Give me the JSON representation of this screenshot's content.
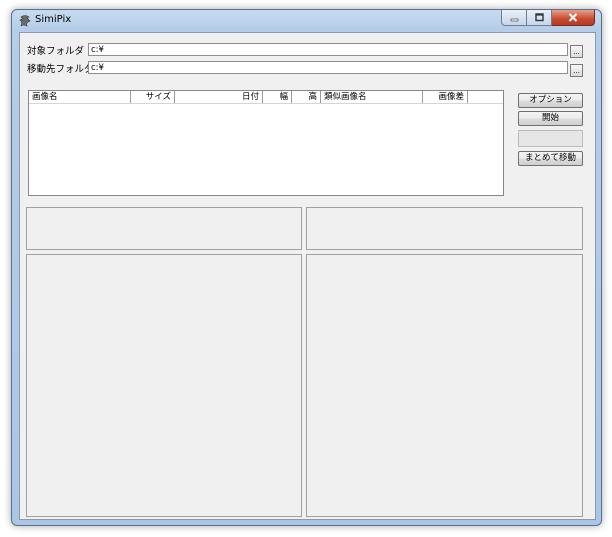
{
  "window": {
    "title": "SimiPix"
  },
  "folders": {
    "target_label": "対象フォルダ",
    "target_value": "c:¥",
    "dest_label": "移動先フォルダ",
    "dest_value": "c:¥",
    "browse_label": "..."
  },
  "list": {
    "columns": [
      "画像名",
      "サイズ",
      "日付",
      "幅",
      "高",
      "類似画像名",
      "画像差"
    ]
  },
  "buttons": {
    "options": "オプション",
    "start": "開始",
    "move_all": "まとめて移動"
  },
  "progress": {
    "fraction": 0
  }
}
